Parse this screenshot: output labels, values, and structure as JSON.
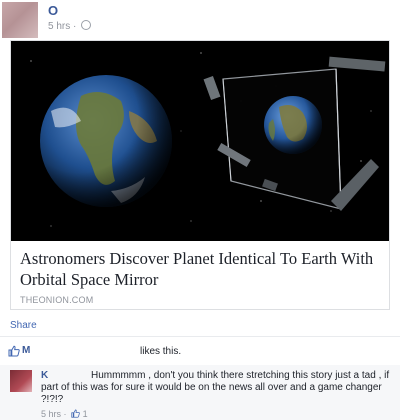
{
  "post": {
    "author": "O",
    "time": "5 hrs",
    "separator": "·"
  },
  "link_card": {
    "title": "Astronomers Discover Planet Identical To Earth With Orbital Space Mirror",
    "source": "THEONION.COM"
  },
  "actions": {
    "share": "Share"
  },
  "likes": {
    "names": "M",
    "suffix": "likes this."
  },
  "comment": {
    "author": "K",
    "text": "Hummmmm , don't you think there stretching this story just a tad , if part of this was for sure it would be on the news all over and a game changer ?!?!?",
    "time": "5 hrs",
    "separator": "·",
    "like_count": "1"
  },
  "colors": {
    "link_blue": "#3b5998",
    "share_blue": "#4267b2",
    "meta_gray": "#90949c",
    "space": "#000000",
    "ocean": "#1f4f8f"
  },
  "icons": [
    "globe-icon",
    "thumbs-up-icon"
  ]
}
